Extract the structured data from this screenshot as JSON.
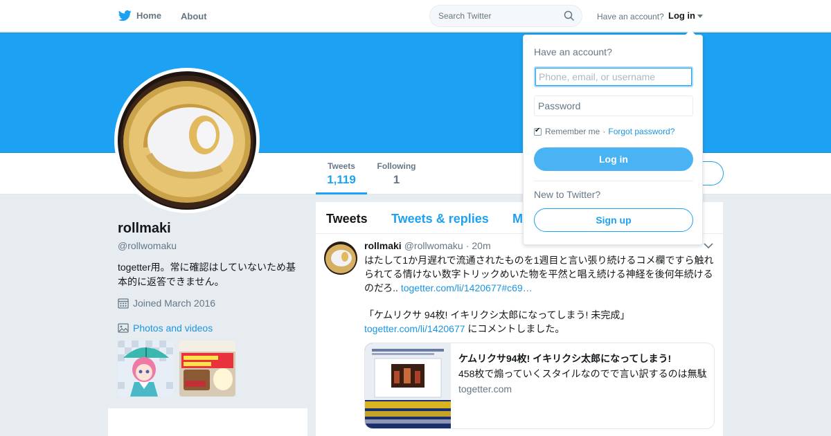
{
  "nav": {
    "home_label": "Home",
    "about_label": "About",
    "search_placeholder": "Search Twitter",
    "have_account": "Have an account?",
    "login_label": "Log in",
    "bird_icon": "twitter-bird-icon",
    "search_icon": "search-icon"
  },
  "colors": {
    "accent": "#1da1f2",
    "banner": "#1da1f2",
    "link": "#1b95e0",
    "login_button": "#4ab3f4"
  },
  "profile_nav": {
    "tweets_label": "Tweets",
    "tweets_count": "1,119",
    "following_label": "Following",
    "following_count": "1"
  },
  "profile": {
    "name": "rollmaki",
    "handle": "@rollwomaku",
    "bio": "togetter用。常に確認はしていないため基本的に返答できません。",
    "joined": "Joined March 2016",
    "photos_label": "Photos and videos"
  },
  "timeline": {
    "tabs": [
      "Tweets",
      "Tweets & replies",
      "M"
    ],
    "tweet": {
      "name": "rollmaki",
      "handle": "@rollwomaku",
      "sep": "·",
      "time": "20m",
      "text": "はたして1か月遅れで流通されたものを1週目と言い張り続けるコメ欄ですら触れられてる情けない数字トリックめいた物を平然と唱え続ける神経を後何年続けるのだろ.. ",
      "link1": "togetter.com/li/1420677#c69…",
      "text2_a": "「ケムリクサ 94枚! イキリクシ太郎になってしまう! 未完成」",
      "link2": "togetter.com/li/1420677",
      "text2_b": " にコメントしました。",
      "card_title": "ケムリクサ94枚! イキリクシ太郎になってしまう!",
      "card_desc": "458枚で煽っていくスタイルなのでで言い訳するのは無駄",
      "card_domain": "togetter.com"
    }
  },
  "login_dropdown": {
    "title": "Have an account?",
    "user_placeholder": "Phone, email, or username",
    "pass_placeholder": "Password",
    "remember": "Remember me",
    "sep": "·",
    "forgot": "Forgot password?",
    "login_button": "Log in",
    "new_label": "New to Twitter?",
    "signup_button": "Sign up"
  }
}
